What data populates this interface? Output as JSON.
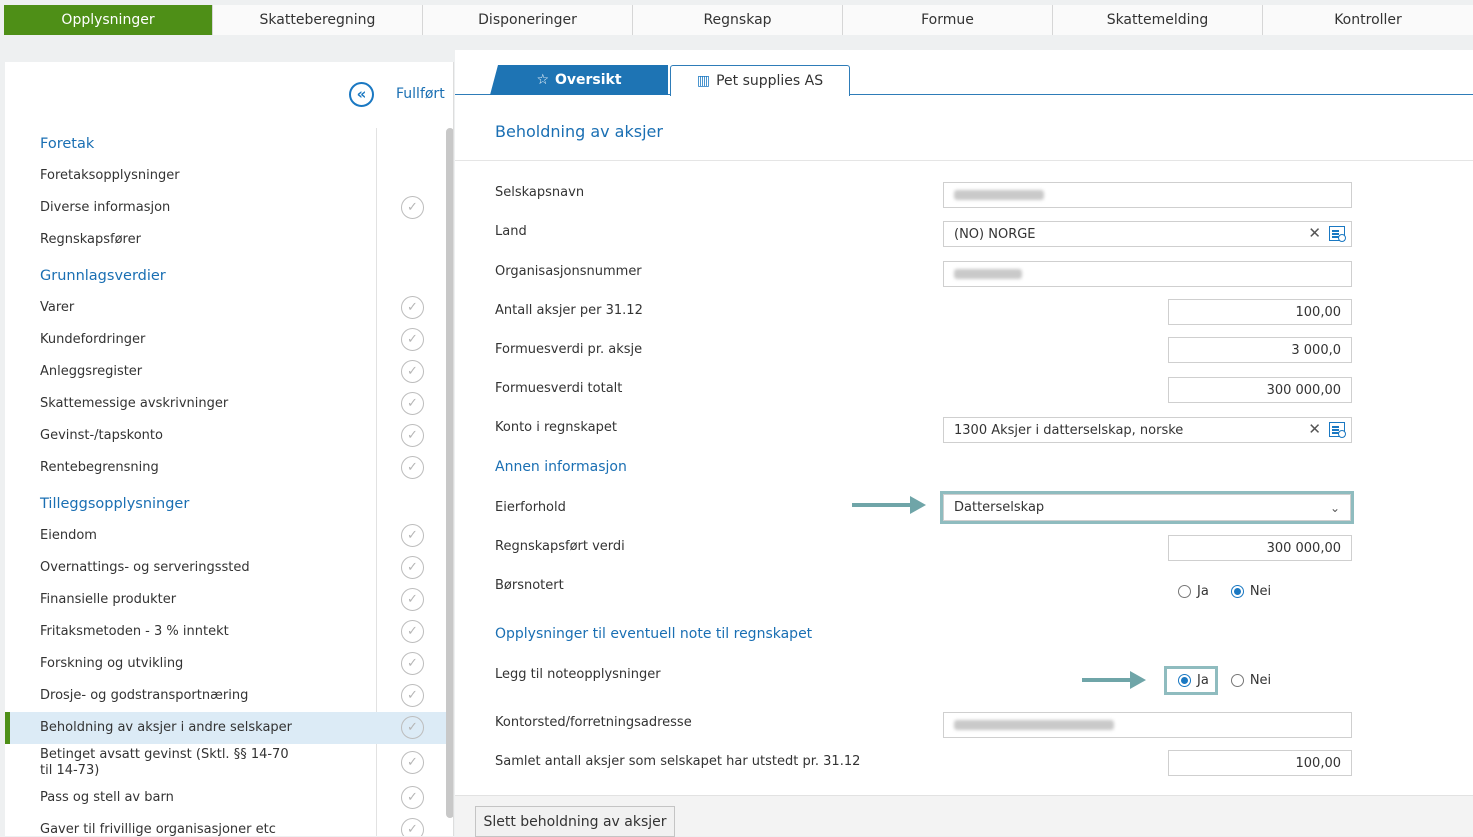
{
  "topnav": {
    "tabs": [
      {
        "label": "Opplysninger",
        "active": true
      },
      {
        "label": "Skatteberegning",
        "active": false
      },
      {
        "label": "Disponeringer",
        "active": false
      },
      {
        "label": "Regnskap",
        "active": false
      },
      {
        "label": "Formue",
        "active": false
      },
      {
        "label": "Skattemelding",
        "active": false
      },
      {
        "label": "Kontroller",
        "active": false
      }
    ]
  },
  "sidebar": {
    "collapse_icon": "double-chevron-left-icon",
    "fullfort_label": "Fullført",
    "items": [
      {
        "label": "Foretak",
        "type": "section"
      },
      {
        "label": "Foretaksopplysninger",
        "type": "item",
        "check": false
      },
      {
        "label": "Diverse informasjon",
        "type": "item",
        "check": true
      },
      {
        "label": "Regnskapsfører",
        "type": "item",
        "check": false
      },
      {
        "label": "Grunnlagsverdier",
        "type": "section"
      },
      {
        "label": "Varer",
        "type": "item",
        "check": true
      },
      {
        "label": "Kundefordringer",
        "type": "item",
        "check": true
      },
      {
        "label": "Anleggsregister",
        "type": "item",
        "check": true
      },
      {
        "label": "Skattemessige avskrivninger",
        "type": "item",
        "check": true
      },
      {
        "label": "Gevinst-/tapskonto",
        "type": "item",
        "check": true
      },
      {
        "label": "Rentebegrensning",
        "type": "item",
        "check": true
      },
      {
        "label": "Tilleggsopplysninger",
        "type": "section"
      },
      {
        "label": "Eiendom",
        "type": "item",
        "check": true
      },
      {
        "label": "Overnattings- og serveringssted",
        "type": "item",
        "check": true
      },
      {
        "label": "Finansielle produkter",
        "type": "item",
        "check": true
      },
      {
        "label": "Fritaksmetoden - 3 % inntekt",
        "type": "item",
        "check": true
      },
      {
        "label": "Forskning og utvikling",
        "type": "item",
        "check": true
      },
      {
        "label": "Drosje- og godstransportnæring",
        "type": "item",
        "check": true
      },
      {
        "label": "Beholdning av aksjer i andre selskaper",
        "type": "item",
        "check": true,
        "active": true
      },
      {
        "label": "Betinget avsatt gevinst (Sktl. §§ 14-70 til 14-73)",
        "type": "item",
        "check": true,
        "twoline": true
      },
      {
        "label": "Pass og stell av barn",
        "type": "item",
        "check": true
      },
      {
        "label": "Gaver til frivillige organisasjoner etc",
        "type": "item",
        "check": true
      }
    ]
  },
  "main": {
    "tabs": {
      "oversikt": "Oversikt",
      "company": "Pet supplies AS"
    },
    "title": "Beholdning av aksjer",
    "fields": {
      "selskapsnavn_label": "Selskapsnavn",
      "land_label": "Land",
      "land_value": "(NO) NORGE",
      "orgnr_label": "Organisasjonsnummer",
      "antall_label": "Antall aksjer per 31.12",
      "antall_value": "100,00",
      "formuesverdi_pr_label": "Formuesverdi pr. aksje",
      "formuesverdi_pr_value": "3 000,0",
      "formuesverdi_tot_label": "Formuesverdi totalt",
      "formuesverdi_tot_value": "300 000,00",
      "konto_label": "Konto i regnskapet",
      "konto_value": "1300 Aksjer i datterselskap, norske"
    },
    "annen_title": "Annen informasjon",
    "annen": {
      "eierforhold_label": "Eierforhold",
      "eierforhold_value": "Datterselskap",
      "regnskapsfort_label": "Regnskapsført verdi",
      "regnskapsfort_value": "300 000,00",
      "borsnotert_label": "Børsnotert",
      "ja": "Ja",
      "nei": "Nei"
    },
    "note_title": "Opplysninger til eventuell note til regnskapet",
    "note": {
      "legg_til_label": "Legg til noteopplysninger",
      "ja": "Ja",
      "nei": "Nei",
      "kontorsted_label": "Kontorsted/forretningsadresse",
      "samlet_label": "Samlet antall aksjer som selskapet har utstedt pr. 31.12",
      "samlet_value": "100,00"
    },
    "delete_button": "Slett beholdning av aksjer"
  }
}
